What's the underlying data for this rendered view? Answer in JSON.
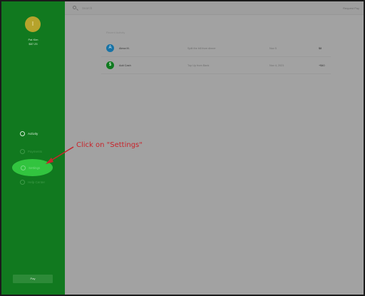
{
  "sidebar": {
    "avatar_initial": "I",
    "user_name": "Pat Kim",
    "user_balance": "$87.25",
    "items": [
      {
        "label": "Activity",
        "icon": "clock-icon"
      },
      {
        "label": "Payments",
        "icon": "dollar-icon"
      },
      {
        "label": "Settings",
        "icon": "gear-icon"
      },
      {
        "label": "Help Center",
        "icon": "help-icon"
      }
    ],
    "bottom_button": "Pay"
  },
  "topbar": {
    "search_placeholder": "Search",
    "right_text": "Request Pay"
  },
  "main": {
    "section_label": "Recent Activity",
    "rows": [
      {
        "icon_letter": "A",
        "name": "Alexa M.",
        "description": "Split the bill from dinner",
        "date": "Nov 5",
        "amount": "$8"
      },
      {
        "icon_letter": "$",
        "name": "Add Cash",
        "description": "Top Up from Bank",
        "date": "Nov 4, 2021",
        "amount": "+$40"
      }
    ]
  },
  "annotation": {
    "text": "Click on \"Settings\"",
    "color": "#c8242b"
  },
  "colors": {
    "sidebar": "#11791f",
    "highlight": "#32c43f",
    "overlay": "#a2a2a2"
  }
}
